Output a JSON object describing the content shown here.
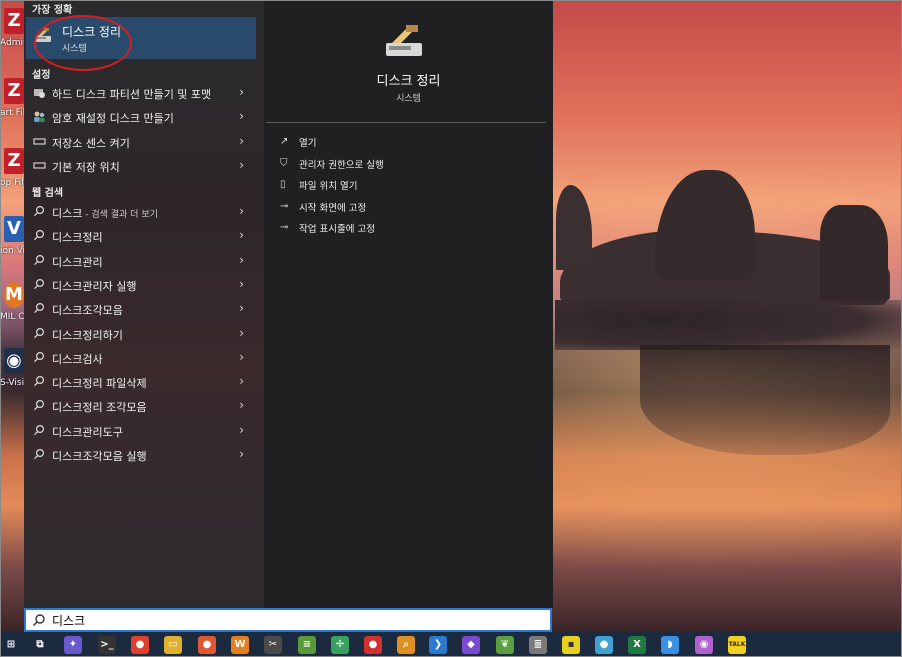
{
  "desktop": {
    "icons": [
      {
        "name": "filezilla-admin-icon",
        "caption": "Admini FileZill",
        "glyph": "Z"
      },
      {
        "name": "filezilla-start-icon",
        "caption": "art File Serve",
        "glyph": "Z"
      },
      {
        "name": "filezilla-stop-icon",
        "caption": "op File Serve",
        "glyph": "Z"
      },
      {
        "name": "vision-app-icon",
        "caption": "ion Vi",
        "glyph": "V"
      },
      {
        "name": "mil-control-icon",
        "caption": "MIL Cor Cent",
        "glyph": "M"
      },
      {
        "name": "s-vision-icon",
        "caption": "S-Visi",
        "glyph": "◉"
      }
    ]
  },
  "search_panel": {
    "best_match_label": "가장 정확",
    "best_match": {
      "title": "디스크 정리",
      "subtitle": "시스템",
      "icon": "disk-cleanup-icon"
    },
    "settings_label": "설정",
    "settings_items": [
      {
        "label": "하드 디스크 파티션 만들기 및 포맷",
        "icon": "partition-icon"
      },
      {
        "label": "암호 재설정 디스크 만들기",
        "icon": "users-icon"
      },
      {
        "label": "저장소 센스 켜기",
        "icon": "storage-icon"
      },
      {
        "label": "기본 저장 위치",
        "icon": "storage-icon"
      }
    ],
    "web_label": "웹 검색",
    "web_items": [
      {
        "label": "디스크",
        "suffix": " - 검색 결과 더 보기"
      },
      {
        "label": "디스크정리",
        "suffix": ""
      },
      {
        "label": "디스크관리",
        "suffix": ""
      },
      {
        "label": "디스크관리자 실행",
        "suffix": ""
      },
      {
        "label": "디스크조각모음",
        "suffix": ""
      },
      {
        "label": "디스크정리하기",
        "suffix": ""
      },
      {
        "label": "디스크검사",
        "suffix": ""
      },
      {
        "label": "디스크정리 파일삭제",
        "suffix": ""
      },
      {
        "label": "디스크정리 조각모음",
        "suffix": ""
      },
      {
        "label": "디스크관리도구",
        "suffix": ""
      },
      {
        "label": "디스크조각모음 실행",
        "suffix": ""
      }
    ]
  },
  "detail_pane": {
    "title": "디스크 정리",
    "subtitle": "시스템",
    "actions": [
      {
        "label": "열기",
        "icon": "open-icon"
      },
      {
        "label": "관리자 권한으로 실행",
        "icon": "admin-icon"
      },
      {
        "label": "파일 위치 열기",
        "icon": "file-location-icon"
      },
      {
        "label": "시작 화면에 고정",
        "icon": "pin-icon"
      },
      {
        "label": "작업 표시줄에 고정",
        "icon": "pin-icon"
      }
    ]
  },
  "search_box": {
    "value": "디스크"
  },
  "taskbar": {
    "items": [
      {
        "name": "start-button-icon",
        "glyph": "⊞",
        "color": "#1b2a3e"
      },
      {
        "name": "task-view-icon",
        "glyph": "⧉",
        "color": "#1b2a3e"
      },
      {
        "name": "copilot-icon",
        "glyph": "✦",
        "color": "#6a5acd"
      },
      {
        "name": "terminal-icon",
        "glyph": ">_",
        "color": "#333333"
      },
      {
        "name": "chrome-icon",
        "glyph": "●",
        "color": "#e04030"
      },
      {
        "name": "file-explorer-icon",
        "glyph": "▭",
        "color": "#e0b030"
      },
      {
        "name": "duckduckgo-icon",
        "glyph": "●",
        "color": "#de5833"
      },
      {
        "name": "winamp-icon",
        "glyph": "W",
        "color": "#e08020"
      },
      {
        "name": "snipping-icon",
        "glyph": "✂",
        "color": "#4a4a4a"
      },
      {
        "name": "notepad-icon",
        "glyph": "≡",
        "color": "#5a9a3a"
      },
      {
        "name": "fan-app-icon",
        "glyph": "✢",
        "color": "#3aa060"
      },
      {
        "name": "red-app-icon",
        "glyph": "●",
        "color": "#d03030"
      },
      {
        "name": "search-app-icon",
        "glyph": "⌕",
        "color": "#e09020"
      },
      {
        "name": "vscode-icon",
        "glyph": "❯",
        "color": "#2a7ad0"
      },
      {
        "name": "visual-studio-icon",
        "glyph": "◆",
        "color": "#7a4ad0"
      },
      {
        "name": "spring-icon",
        "glyph": "❦",
        "color": "#5aa040"
      },
      {
        "name": "database-icon",
        "glyph": "≣",
        "color": "#7a7a7a"
      },
      {
        "name": "sticky-notes-icon",
        "glyph": "▪",
        "color": "#e8d020"
      },
      {
        "name": "chrome-dev-icon",
        "glyph": "●",
        "color": "#40a0d0"
      },
      {
        "name": "excel-icon",
        "glyph": "X",
        "color": "#1e7a40"
      },
      {
        "name": "whale-browser-icon",
        "glyph": "◗",
        "color": "#3a90e0"
      },
      {
        "name": "purple-app-icon",
        "glyph": "◉",
        "color": "#b060d0"
      },
      {
        "name": "kakaotalk-icon",
        "glyph": "TALK",
        "color": "#f0d020"
      }
    ]
  }
}
